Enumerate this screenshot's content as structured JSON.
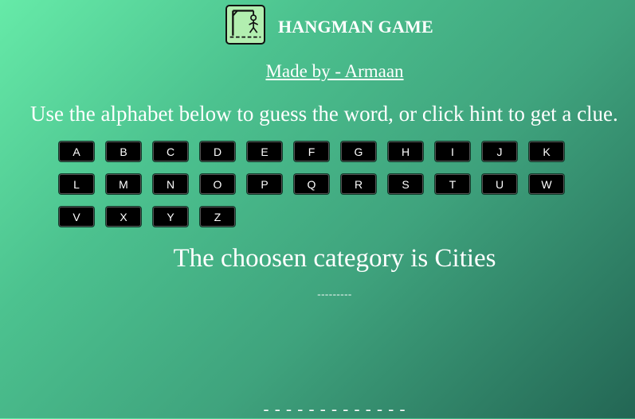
{
  "header": {
    "title": "HANGMAN GAME",
    "logo_icon": "hangman-gallows-icon"
  },
  "credit": "Made by - Armaan",
  "instructions": "Use the alphabet below to guess the word, or click hint to get a clue.",
  "alphabet": [
    "A",
    "B",
    "C",
    "D",
    "E",
    "F",
    "G",
    "H",
    "I",
    "J",
    "K",
    "L",
    "M",
    "N",
    "O",
    "P",
    "Q",
    "R",
    "S",
    "T",
    "U",
    "W",
    "V",
    "X",
    "Y",
    "Z"
  ],
  "category_text": "The choosen category is Cities",
  "hidden_word": "---------",
  "lives_display": "- - - - - - - - - - - - -",
  "colors": {
    "background_start": "#66eaa8",
    "background_end": "#236654",
    "key_background": "#000000",
    "text": "#ffffff"
  }
}
